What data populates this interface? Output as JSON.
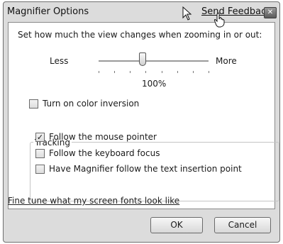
{
  "window": {
    "title": "Magnifier Options",
    "feedback_link": "Send Feedback",
    "close_glyph": "✕"
  },
  "zoom": {
    "instruction": "Set how much the view changes when zooming in or out:",
    "less_label": "Less",
    "more_label": "More",
    "value_label": "100%",
    "slider_fraction": 0.4,
    "tick_count": 8
  },
  "color_inversion": {
    "label": "Turn on color inversion",
    "checked": false
  },
  "tracking": {
    "group_label": "Tracking",
    "options": [
      {
        "label": "Follow the mouse pointer",
        "checked": true
      },
      {
        "label": "Follow the keyboard focus",
        "checked": false
      },
      {
        "label": "Have Magnifier follow the text insertion point",
        "checked": false
      }
    ]
  },
  "fonts_link": "Fine tune what my screen fonts look like",
  "buttons": {
    "ok": "OK",
    "cancel": "Cancel"
  },
  "icons": {
    "cursor_arrow": "arrow-cursor-icon",
    "cursor_hand": "hand-cursor-icon",
    "checkmark": "✓"
  }
}
